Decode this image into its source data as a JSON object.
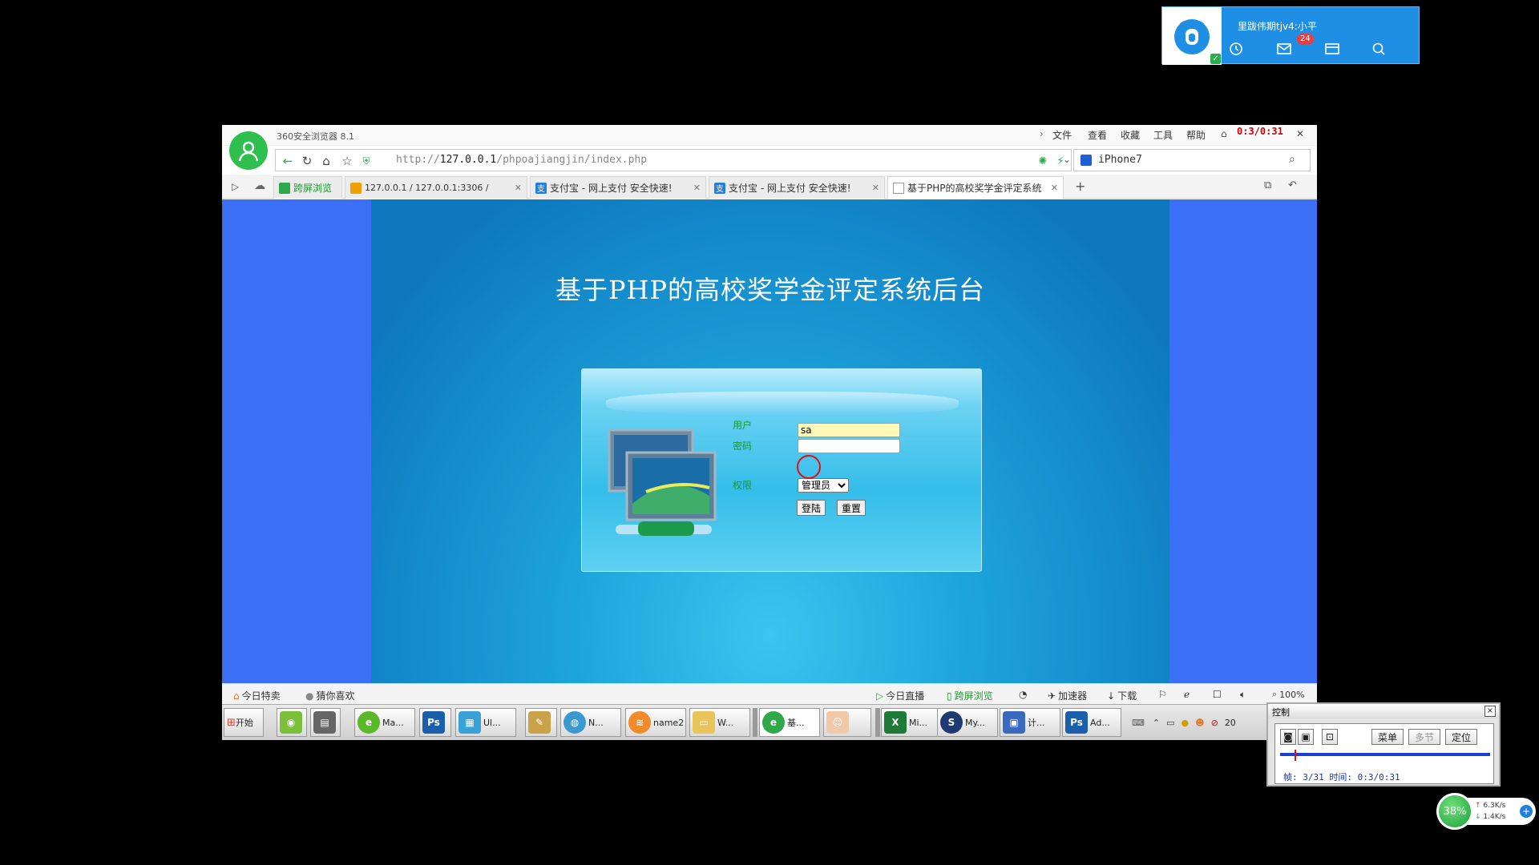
{
  "qq_widget": {
    "username": "里跋伟期tjv4:小平",
    "mail_badge": "24",
    "icons": [
      "qq-logo-icon",
      "clock-icon",
      "mail-icon",
      "window-icon",
      "search-icon"
    ]
  },
  "browser": {
    "app_title": "360安全浏览器 8.1",
    "menu": [
      "文件",
      "查看",
      "收藏",
      "工具",
      "帮助"
    ],
    "recording_timer": "0:3/0:31",
    "url_prefix": "http://",
    "url_host": "127.0.0.1",
    "url_path": "/phpoajiangjin/index.php",
    "search_value": "iPhone7",
    "tabs": [
      {
        "label": "跨屏浏览",
        "icon": "phone-icon"
      },
      {
        "label": "127.0.0.1 / 127.0.0.1:3306 / ",
        "icon": "phpmyadmin-icon"
      },
      {
        "label": "支付宝 - 网上支付 安全快速!",
        "icon": "alipay-icon"
      },
      {
        "label": "支付宝 - 网上支付 安全快速!",
        "icon": "alipay-icon"
      },
      {
        "label": "基于PHP的高校奖学金评定系统",
        "icon": "page-icon"
      }
    ],
    "new_tab": "+"
  },
  "login_page": {
    "heading": "基于PHP的高校奖学金评定系统后台",
    "user_label": "用户",
    "user_value": "sa",
    "password_label": "密码",
    "password_value": "",
    "role_label": "权限",
    "role_selected": "管理员",
    "login_button": "登陆",
    "reset_button": "重置"
  },
  "statusbar": {
    "left": [
      "今日特卖",
      "猜你喜欢"
    ],
    "right": [
      "今日直播",
      "跨屏浏览",
      "加速器",
      "下载"
    ],
    "zoom": "100%"
  },
  "taskbar": {
    "start": "开始",
    "items": [
      "Ma...",
      "Ul...",
      "N...",
      "name2",
      "W...",
      "基...",
      "Mi...",
      "My...",
      "计...",
      "Ad..."
    ],
    "clock": "20"
  },
  "control_dialog": {
    "title": "控制",
    "menu_button": "菜单",
    "multi_button": "多节",
    "locate_button": "定位",
    "frame_info": "帧: 3/31 时间: 0:3/0:31"
  },
  "speed_widget": {
    "percent": "38%",
    "upload": "6.3K/s",
    "download": "1.4K/s"
  },
  "colors": {
    "page_bg": "#3b6ff5",
    "login_label": "#1a9a2a",
    "qq_blue": "#1e8fe4"
  }
}
